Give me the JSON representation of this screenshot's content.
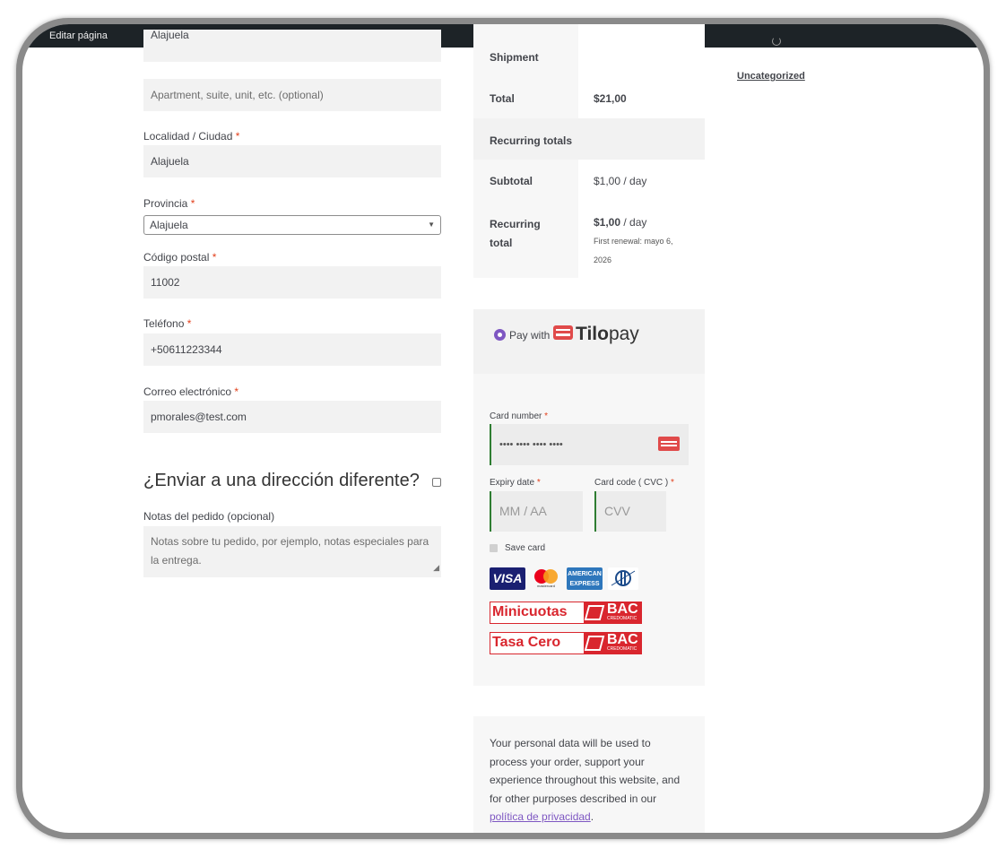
{
  "adminbar": {
    "edit_label": "Editar página"
  },
  "billing": {
    "city_top_value": "Alajuela",
    "apartment_placeholder": "Apartment, suite, unit, etc. (optional)",
    "city_label": "Localidad / Ciudad",
    "city_value": "Alajuela",
    "province_label": "Provincia",
    "province_value": "Alajuela",
    "postal_label": "Código postal",
    "postal_value": "11002",
    "phone_label": "Teléfono",
    "phone_value": "+50611223344",
    "email_label": "Correo electrónico",
    "email_value": "pmorales@test.com",
    "required_mark": "*"
  },
  "shipping": {
    "different_address_heading": "¿Enviar a una dirección diferente?",
    "notes_label": "Notas del pedido (opcional)",
    "notes_placeholder": "Notas sobre tu pedido, por ejemplo, notas especiales para la entrega."
  },
  "totals": {
    "shipment_label": "Shipment",
    "total_label": "Total",
    "total_value": "$21,00",
    "recurring_totals_label": "Recurring totals",
    "subtotal_label": "Subtotal",
    "subtotal_amount": "$1,00",
    "subtotal_period": " / day",
    "recurring_total_label_1": "Recurring",
    "recurring_total_label_2": "total",
    "recurring_total_amount": "$1,00",
    "recurring_total_period": " / day",
    "first_renewal_1": "First renewal: mayo 6,",
    "first_renewal_2": "2026"
  },
  "payment": {
    "pay_with_label": "Pay with",
    "brand_tilo": "Tilo",
    "brand_pay": "pay",
    "card_number_label": "Card number",
    "card_number_placeholder": "•••• •••• •••• ••••",
    "expiry_label": "Expiry date",
    "expiry_placeholder": "MM / AA",
    "cvc_label": "Card code ( CVC )",
    "cvc_placeholder": "CVV",
    "save_card_label": "Save card",
    "visa_label": "VISA",
    "mastercard_label": "mastercard",
    "amex_label_1": "AMERICAN",
    "amex_label_2": "EXPRESS",
    "minicuotas_label": "Minicuotas",
    "tasacero_label": "Tasa Cero",
    "bac_label": "BAC",
    "bac_sub": "CREDOMATIC",
    "accent_color": "#7e57c2",
    "bac_color": "#d9262e"
  },
  "privacy": {
    "text": "Your personal data will be used to process your order, support your experience throughout this website, and for other purposes described in our ",
    "link_text": "política de privacidad",
    "end": "."
  },
  "sidebar": {
    "category_link": "Uncategorized"
  }
}
